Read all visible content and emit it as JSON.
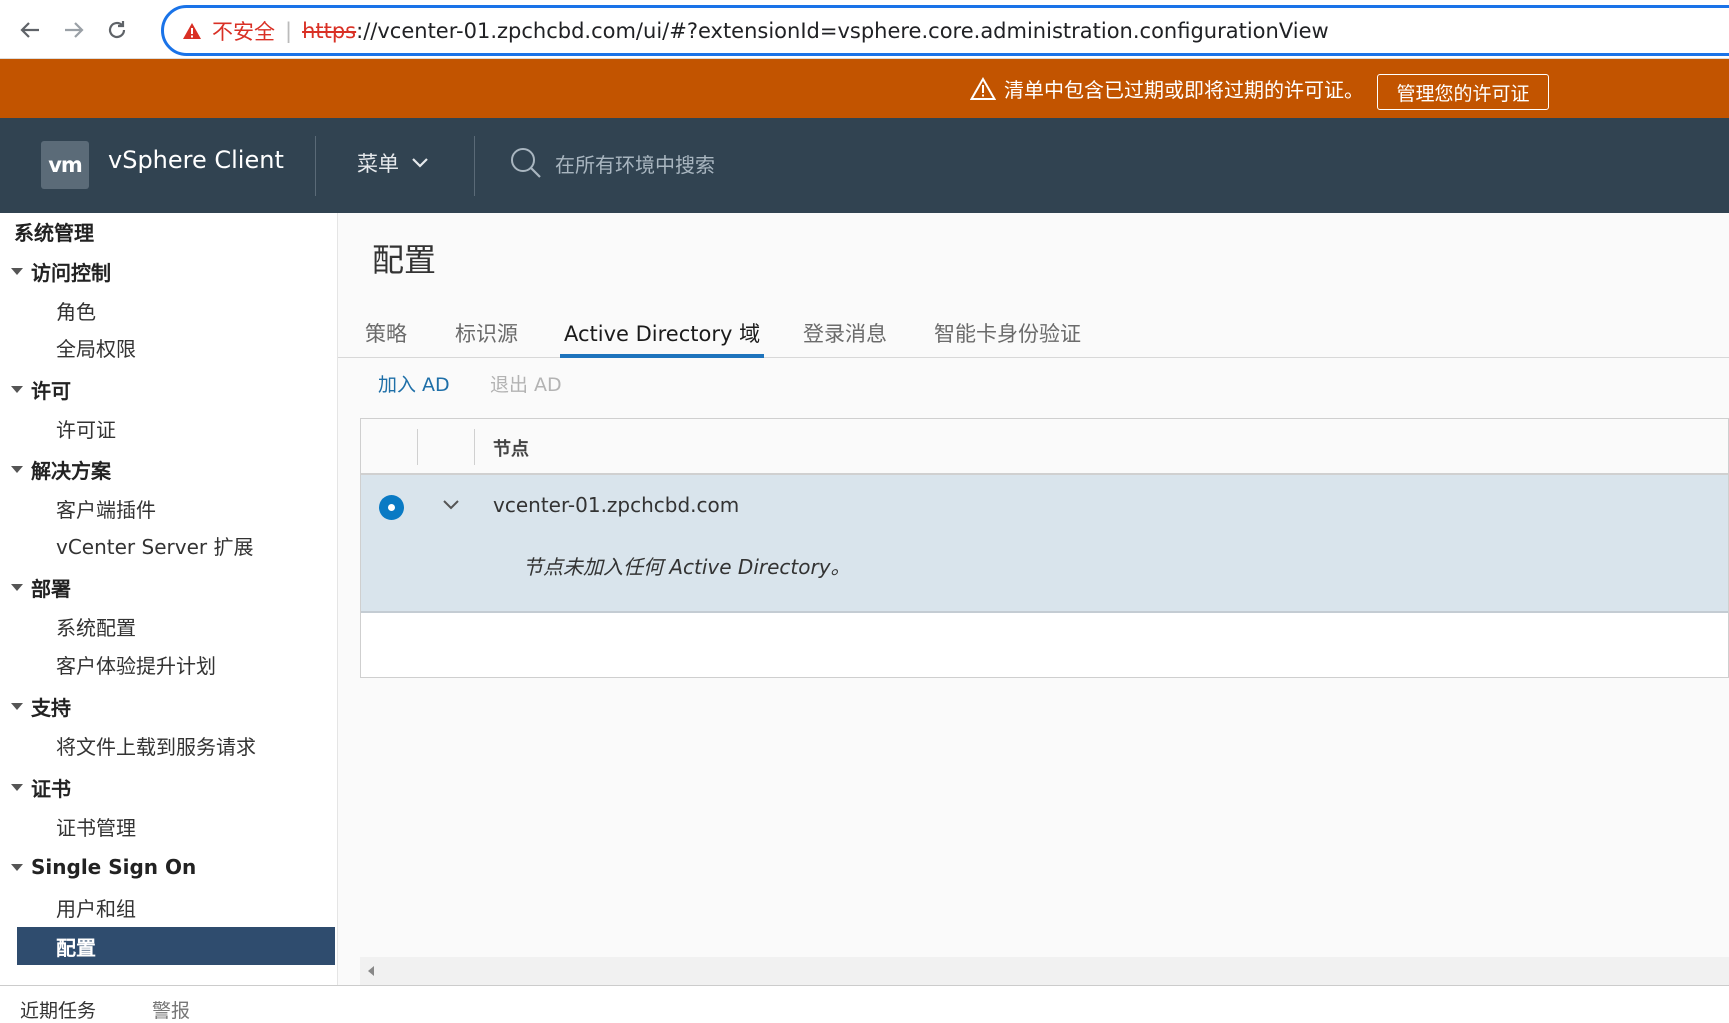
{
  "browser": {
    "back_icon": "arrow-left-icon",
    "forward_icon": "arrow-right-icon",
    "reload_icon": "reload-icon",
    "security_label": "不安全",
    "url_scheme": "https",
    "url_rest": "://vcenter-01.zpchcbd.com/ui/#?extensionId=vsphere.core.administration.configurationView"
  },
  "license_banner": {
    "message": "清单中包含已过期或即将过期的许可证。",
    "button": "管理您的许可证",
    "background": "#c25400"
  },
  "header": {
    "logo": "vm",
    "app_title": "vSphere Client",
    "menu_label": "菜单",
    "search_placeholder": "在所有环境中搜索",
    "background": "#314351"
  },
  "sidebar": {
    "title": "系统管理",
    "sections": [
      {
        "label": "访问控制",
        "items": [
          "角色",
          "全局权限"
        ]
      },
      {
        "label": "许可",
        "items": [
          "许可证"
        ]
      },
      {
        "label": "解决方案",
        "items": [
          "客户端插件",
          "vCenter Server 扩展"
        ]
      },
      {
        "label": "部署",
        "items": [
          "系统配置",
          "客户体验提升计划"
        ]
      },
      {
        "label": "支持",
        "items": [
          "将文件上载到服务请求"
        ]
      },
      {
        "label": "证书",
        "items": [
          "证书管理"
        ]
      },
      {
        "label": "Single Sign On",
        "items": [
          "用户和组",
          "配置"
        ]
      }
    ],
    "selected_item": "配置",
    "selected_color": "#2f4c6e"
  },
  "main": {
    "title": "配置",
    "tabs": [
      "策略",
      "标识源",
      "Active Directory 域",
      "登录消息",
      "智能卡身份验证"
    ],
    "active_tab": "Active Directory 域",
    "actions": {
      "join": "加入 AD",
      "leave": "退出 AD"
    },
    "grid": {
      "column_node": "节点",
      "rows": [
        {
          "node": "vcenter-01.zpchcbd.com",
          "detail": "节点未加入任何 Active Directory。",
          "selected": true,
          "expanded": true
        }
      ]
    }
  },
  "bottom": {
    "tabs": [
      "近期任务",
      "警报"
    ]
  }
}
